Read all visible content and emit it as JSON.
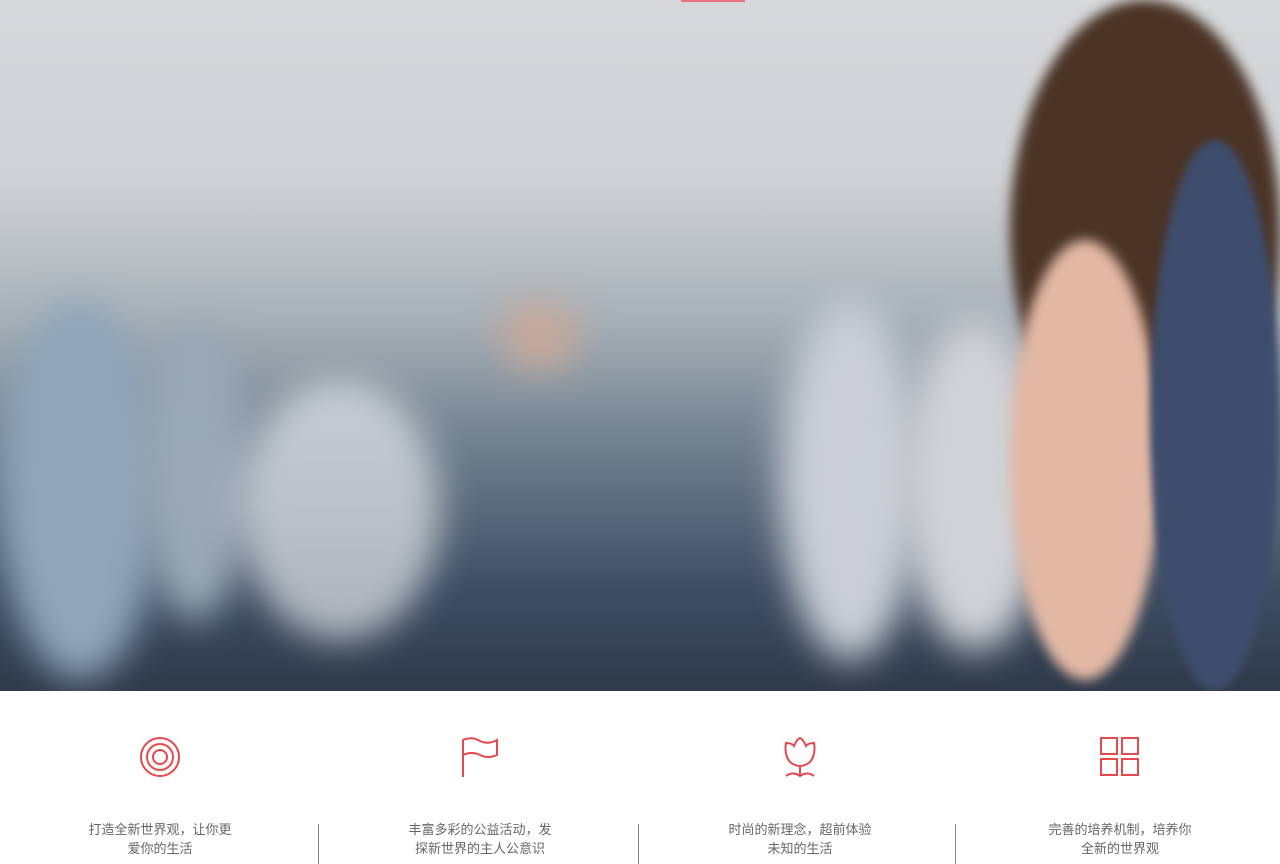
{
  "hero": {
    "image": "airplane-cabin-photo",
    "accent": "#e8727f"
  },
  "features": [
    {
      "icon": "target-icon",
      "line1": "打造全新世界观，让你更",
      "line2": "爱你的生活"
    },
    {
      "icon": "flag-icon",
      "line1": "丰富多彩的公益活动，发",
      "line2": "探新世界的主人公意识"
    },
    {
      "icon": "tulip-icon",
      "line1": "时尚的新理念，超前体验",
      "line2": "未知的生活"
    },
    {
      "icon": "grid-icon",
      "line1": "完善的培养机制，培养你",
      "line2": "全新的世界观"
    }
  ],
  "colors": {
    "icon": "#e5484d",
    "text": "#666666"
  }
}
